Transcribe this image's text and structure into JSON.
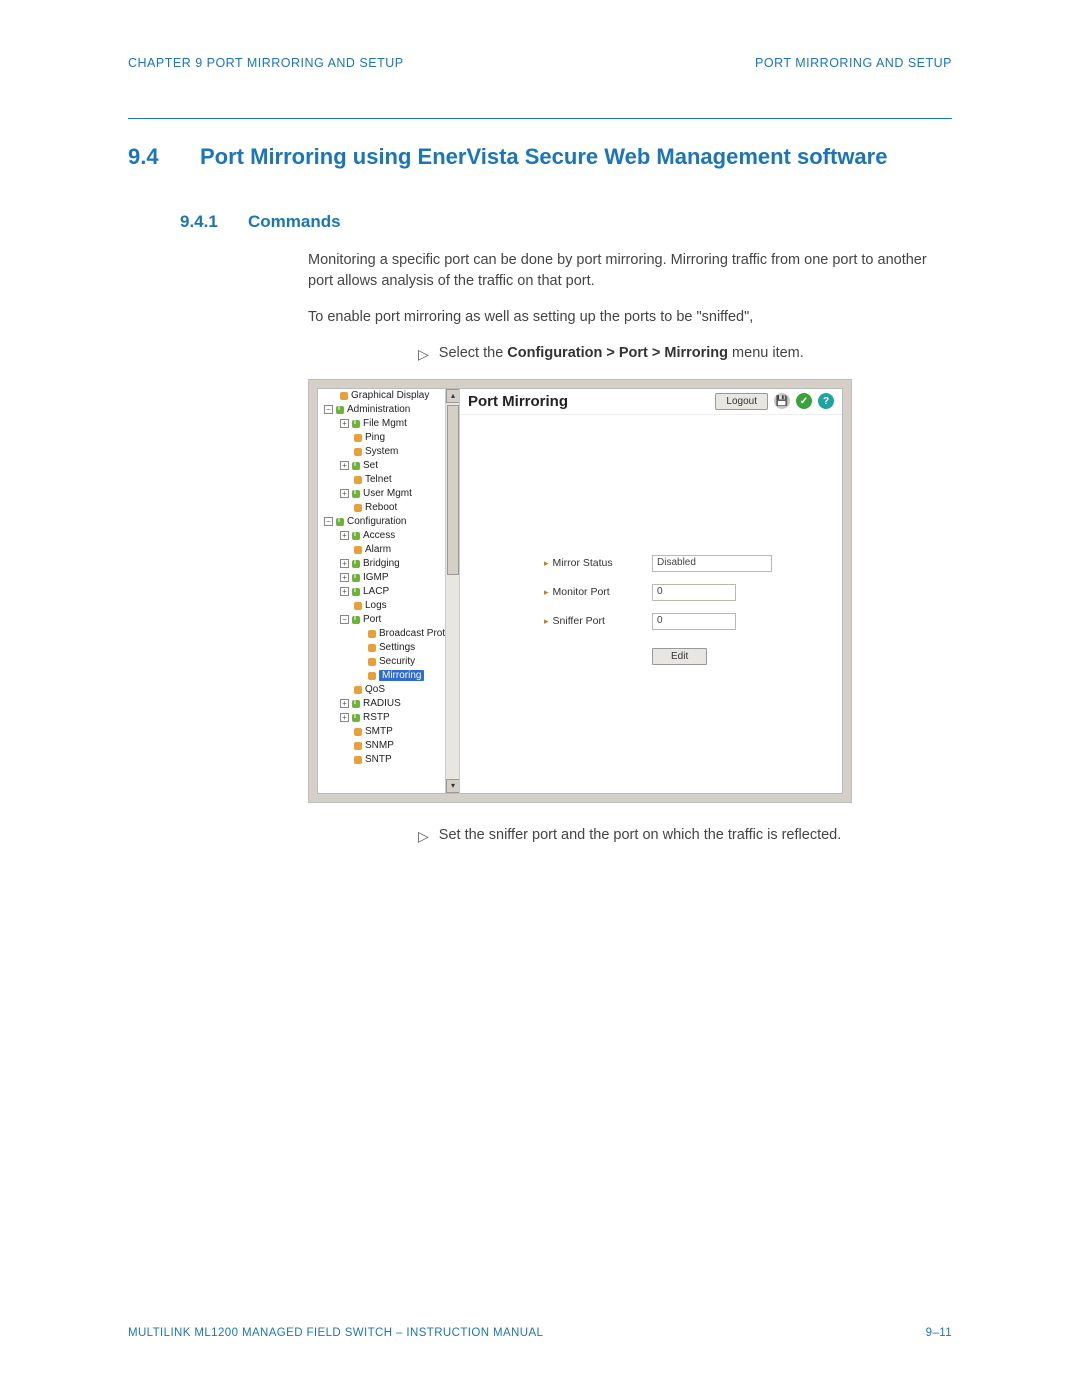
{
  "header": {
    "left": "CHAPTER 9  PORT MIRRORING AND SETUP",
    "right": "PORT MIRRORING AND SETUP"
  },
  "h1": {
    "num": "9.4",
    "title": "Port Mirroring using EnerVista Secure Web Management software"
  },
  "h2": {
    "num": "9.4.1",
    "title": "Commands"
  },
  "para1": "Monitoring a specific port can be done by port mirroring. Mirroring traffic from one port to another port allows analysis of the traffic on that port.",
  "para2": "To enable port mirroring as well as setting up the ports to be \"sniffed\",",
  "instr1_pre": "Select the ",
  "instr1_bold": "Configuration > Port > Mirroring",
  "instr1_post": " menu item.",
  "instr2": "Set the sniffer port and the port on which the traffic is reflected.",
  "shot": {
    "title": "Port Mirroring",
    "logout": "Logout",
    "icons": {
      "save": "💾",
      "refresh": "✓",
      "help": "?"
    },
    "form": {
      "l1": "Mirror Status",
      "v1": "Disabled",
      "l2": "Monitor Port",
      "v2": "0",
      "l3": "Sniffer Port",
      "v3": "0",
      "edit": "Edit"
    },
    "tree": [
      {
        "t": "Graphical Display",
        "cls": "ind2",
        "ic": "arrow"
      },
      {
        "t": "Administration",
        "cls": "ind1",
        "pm": "−",
        "ic": "info"
      },
      {
        "t": "File Mgmt",
        "cls": "ind2",
        "pm": "+",
        "ic": "info"
      },
      {
        "t": "Ping",
        "cls": "ind3",
        "ic": "arrow"
      },
      {
        "t": "System",
        "cls": "ind3",
        "ic": "arrow"
      },
      {
        "t": "Set",
        "cls": "ind2",
        "pm": "+",
        "ic": "info"
      },
      {
        "t": "Telnet",
        "cls": "ind3",
        "ic": "arrow"
      },
      {
        "t": "User Mgmt",
        "cls": "ind2",
        "pm": "+",
        "ic": "info"
      },
      {
        "t": "Reboot",
        "cls": "ind3",
        "ic": "arrow"
      },
      {
        "t": "Configuration",
        "cls": "ind1",
        "pm": "−",
        "ic": "info"
      },
      {
        "t": "Access",
        "cls": "ind2",
        "pm": "+",
        "ic": "info"
      },
      {
        "t": "Alarm",
        "cls": "ind3",
        "ic": "arrow"
      },
      {
        "t": "Bridging",
        "cls": "ind2",
        "pm": "+",
        "ic": "info"
      },
      {
        "t": "IGMP",
        "cls": "ind2",
        "pm": "+",
        "ic": "info"
      },
      {
        "t": "LACP",
        "cls": "ind2",
        "pm": "+",
        "ic": "info"
      },
      {
        "t": "Logs",
        "cls": "ind3",
        "ic": "arrow"
      },
      {
        "t": "Port",
        "cls": "ind2",
        "pm": "−",
        "ic": "info"
      },
      {
        "t": "Broadcast Protect",
        "cls": "ind4",
        "ic": "arrow"
      },
      {
        "t": "Settings",
        "cls": "ind4",
        "ic": "arrow"
      },
      {
        "t": "Security",
        "cls": "ind4",
        "ic": "arrow"
      },
      {
        "t": "Mirroring",
        "cls": "ind4",
        "ic": "arrow",
        "sel": true
      },
      {
        "t": "QoS",
        "cls": "ind3",
        "ic": "arrow"
      },
      {
        "t": "RADIUS",
        "cls": "ind2",
        "pm": "+",
        "ic": "info"
      },
      {
        "t": "RSTP",
        "cls": "ind2",
        "pm": "+",
        "ic": "info"
      },
      {
        "t": "SMTP",
        "cls": "ind3",
        "ic": "arrow"
      },
      {
        "t": "SNMP",
        "cls": "ind3",
        "ic": "arrow"
      },
      {
        "t": "SNTP",
        "cls": "ind3",
        "ic": "arrow"
      }
    ]
  },
  "footer": {
    "left": "MULTILINK ML1200 MANAGED FIELD SWITCH – INSTRUCTION MANUAL",
    "right": "9–11"
  }
}
